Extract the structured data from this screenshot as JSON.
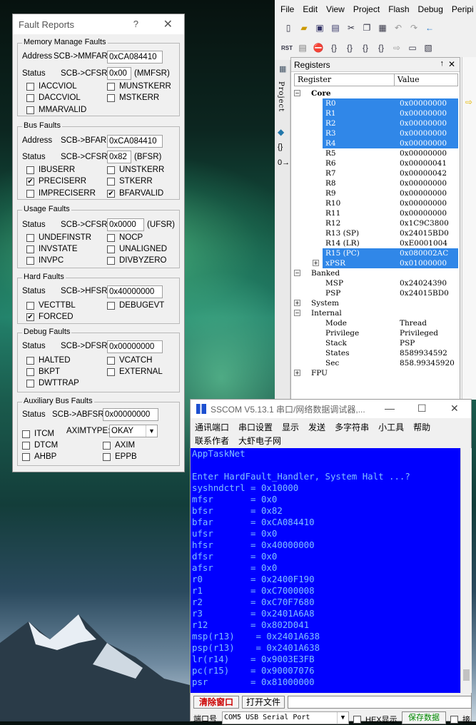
{
  "fault_reports": {
    "title": "Fault Reports",
    "help": "?",
    "close": "✕",
    "memory": {
      "title": "Memory Manage Faults",
      "address_label": "Address",
      "mmfar_label": "SCB->MMFAR:",
      "mmfar_value": "0xCA084410",
      "status_label": "Status",
      "cfsr_label": "SCB->CFSR:",
      "cfsr_value": "0x00",
      "suffix": "(MMFSR)",
      "flags": [
        {
          "label": "IACCVIOL",
          "checked": false
        },
        {
          "label": "MUNSTKERR",
          "checked": false
        },
        {
          "label": "DACCVIOL",
          "checked": false
        },
        {
          "label": "MSTKERR",
          "checked": false
        },
        {
          "label": "MMARVALID",
          "checked": false
        }
      ]
    },
    "bus": {
      "title": "Bus Faults",
      "address_label": "Address",
      "bfar_label": "SCB->BFAR:",
      "bfar_value": "0xCA084410",
      "status_label": "Status",
      "cfsr_label": "SCB->CFSR:",
      "cfsr_value": "0x82",
      "suffix": "(BFSR)",
      "flags": [
        {
          "label": "IBUSERR",
          "checked": false
        },
        {
          "label": "UNSTKERR",
          "checked": false
        },
        {
          "label": "PRECISERR",
          "checked": true
        },
        {
          "label": "STKERR",
          "checked": false
        },
        {
          "label": "IMPRECISERR",
          "checked": false
        },
        {
          "label": "BFARVALID",
          "checked": true
        }
      ]
    },
    "usage": {
      "title": "Usage Faults",
      "status_label": "Status",
      "cfsr_label": "SCB->CFSR:",
      "cfsr_value": "0x0000",
      "suffix": "(UFSR)",
      "flags": [
        {
          "label": "UNDEFINSTR",
          "checked": false
        },
        {
          "label": "NOCP",
          "checked": false
        },
        {
          "label": "INVSTATE",
          "checked": false
        },
        {
          "label": "UNALIGNED",
          "checked": false
        },
        {
          "label": "INVPC",
          "checked": false
        },
        {
          "label": "DIVBYZERO",
          "checked": false
        }
      ]
    },
    "hard": {
      "title": "Hard Faults",
      "status_label": "Status",
      "hfsr_label": "SCB->HFSR:",
      "hfsr_value": "0x40000000",
      "flags": [
        {
          "label": "VECTTBL",
          "checked": false
        },
        {
          "label": "DEBUGEVT",
          "checked": false
        },
        {
          "label": "FORCED",
          "checked": true
        }
      ]
    },
    "debug": {
      "title": "Debug Faults",
      "status_label": "Status",
      "dfsr_label": "SCB->DFSR:",
      "dfsr_value": "0x00000000",
      "flags": [
        {
          "label": "HALTED",
          "checked": false
        },
        {
          "label": "VCATCH",
          "checked": false
        },
        {
          "label": "BKPT",
          "checked": false
        },
        {
          "label": "EXTERNAL",
          "checked": false
        },
        {
          "label": "DWTTRAP",
          "checked": false
        }
      ]
    },
    "aux": {
      "title": "Auxiliary Bus Faults",
      "status_label": "Status",
      "abfsr_label": "SCB->ABFSR:",
      "abfsr_value": "0x00000000",
      "aximtype_label": "AXIMTYPE:",
      "aximtype_value": "OKAY",
      "flags": [
        {
          "label": "ITCM",
          "checked": false
        },
        {
          "label": "DTCM",
          "checked": false
        },
        {
          "label": "AXIM",
          "checked": false
        },
        {
          "label": "AHBP",
          "checked": false
        },
        {
          "label": "EPPB",
          "checked": false
        }
      ]
    }
  },
  "ide": {
    "menu": [
      "File",
      "Edit",
      "View",
      "Project",
      "Flash",
      "Debug",
      "Peripi"
    ],
    "rst_label": "RST",
    "side_tab": "Project",
    "registers": {
      "title": "Registers",
      "col_register": "Register",
      "col_value": "Value",
      "pin": "↑",
      "close": "✕",
      "group_core": "Core",
      "core": [
        {
          "name": "R0",
          "value": "0x00000000",
          "hl": true
        },
        {
          "name": "R1",
          "value": "0x00000000",
          "hl": true
        },
        {
          "name": "R2",
          "value": "0x00000000",
          "hl": true
        },
        {
          "name": "R3",
          "value": "0x00000000",
          "hl": true
        },
        {
          "name": "R4",
          "value": "0x00000000",
          "hl": true
        },
        {
          "name": "R5",
          "value": "0x00000000",
          "hl": false
        },
        {
          "name": "R6",
          "value": "0x00000041",
          "hl": false
        },
        {
          "name": "R7",
          "value": "0x00000042",
          "hl": false
        },
        {
          "name": "R8",
          "value": "0x00000000",
          "hl": false
        },
        {
          "name": "R9",
          "value": "0x00000000",
          "hl": false
        },
        {
          "name": "R10",
          "value": "0x00000000",
          "hl": false
        },
        {
          "name": "R11",
          "value": "0x00000000",
          "hl": false
        },
        {
          "name": "R12",
          "value": "0x1C9C3800",
          "hl": false
        },
        {
          "name": "R13 (SP)",
          "value": "0x24015BD0",
          "hl": false
        },
        {
          "name": "R14 (LR)",
          "value": "0xE0001004",
          "hl": false
        },
        {
          "name": "R15 (PC)",
          "value": "0x080002AC",
          "hl": true
        },
        {
          "name": "xPSR",
          "value": "0x01000000",
          "hl": true
        }
      ],
      "group_banked": "Banked",
      "banked": [
        {
          "name": "MSP",
          "value": "0x24024390"
        },
        {
          "name": "PSP",
          "value": "0x24015BD0"
        }
      ],
      "group_system": "System",
      "group_internal": "Internal",
      "internal": [
        {
          "name": "Mode",
          "value": "Thread"
        },
        {
          "name": "Privilege",
          "value": "Privileged"
        },
        {
          "name": "Stack",
          "value": "PSP"
        },
        {
          "name": "States",
          "value": "8589934592"
        },
        {
          "name": "Sec",
          "value": "858.99345920"
        }
      ],
      "group_fpu": "FPU"
    }
  },
  "sscom": {
    "title": "SSCOM V5.13.1 串口/网络数据调试器,...",
    "menu1": [
      "通讯端口",
      "串口设置",
      "显示",
      "发送",
      "多字符串",
      "小工具",
      "帮助"
    ],
    "menu2": [
      "联系作者",
      "大虾电子网"
    ],
    "terminal": [
      "AppTaskNet",
      "",
      "Enter HardFault_Handler, System Halt ...?",
      "syshndctrl = 0x10000",
      "mfsr       = 0x0",
      "bfsr       = 0x82",
      "bfar       = 0xCA084410",
      "ufsr       = 0x0",
      "hfsr       = 0x40000000",
      "dfsr       = 0x0",
      "afsr       = 0x0",
      "r0         = 0x2400F190",
      "r1         = 0xC7000008",
      "r2         = 0xC70F7680",
      "r3         = 0x2401A6A8",
      "r12        = 0x802D041",
      "msp(r13)    = 0x2401A638",
      "psp(r13)    = 0x2401A638",
      "lr(r14)    = 0x9003E3FB",
      "pc(r15)    = 0x90007076",
      "psr        = 0x81000000"
    ],
    "clear_btn": "清除窗口",
    "open_btn": "打开文件",
    "port_label": "端口号",
    "port_value": "COM5 USB Serial Port",
    "hex_label": "HEX显示",
    "save_label": "保存数据",
    "extra_label": "接"
  }
}
